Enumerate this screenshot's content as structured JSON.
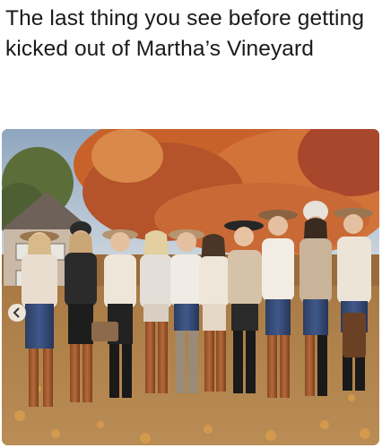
{
  "meme": {
    "caption": "The last thing you see before getting kicked out of Martha’s Vineyard"
  },
  "photo": {
    "icon": "women-group-photo",
    "accent": "#c8622a"
  }
}
